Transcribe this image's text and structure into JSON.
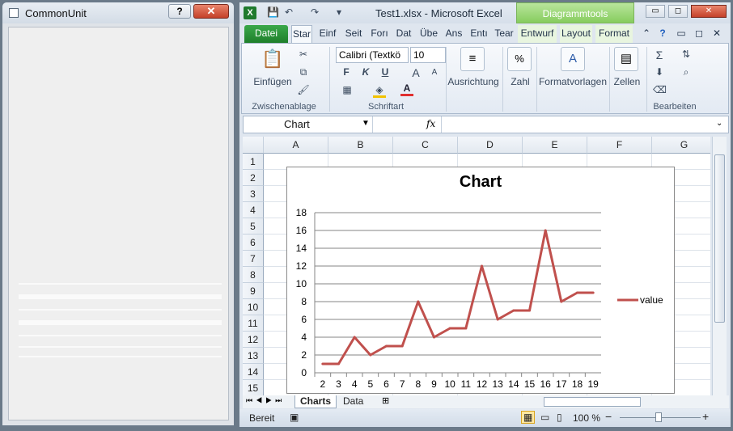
{
  "common_unit": {
    "title": "CommonUnit",
    "help_label": "?",
    "close_label": "✕"
  },
  "excel": {
    "title": "Test1.xlsx  -  Microsoft Excel",
    "icon_letter": "X",
    "context_tab_group": "Diagrammtools",
    "tabs": [
      "Datei",
      "Star",
      "Einf",
      "Seit",
      "Forı",
      "Dat",
      "Übe",
      "Ans",
      "Entı",
      "Tear",
      "Entwurf",
      "Layout",
      "Format"
    ],
    "window_buttons": [
      "▭",
      "◻",
      "✕"
    ],
    "ribbon": {
      "clipboard": {
        "paste": "Einfügen",
        "label": "Zwischenablage"
      },
      "font": {
        "name": "Calibri (Textkö",
        "size": "10",
        "bold": "F",
        "italic": "K",
        "underline": "U",
        "grow": "A",
        "shrink": "A",
        "label": "Schriftart"
      },
      "alignment": "Ausrichtung",
      "number": "Zahl",
      "styles": "Formatvorlagen",
      "cells": "Zellen",
      "editing": "Bearbeiten",
      "number_icon": "%"
    },
    "name_box": "Chart",
    "fx": "fx",
    "columns": [
      "A",
      "B",
      "C",
      "D",
      "E",
      "F",
      "G"
    ],
    "rows": [
      "1",
      "2",
      "3",
      "4",
      "5",
      "6",
      "7",
      "8",
      "9",
      "10",
      "11",
      "12",
      "13",
      "14",
      "15"
    ],
    "sheets": [
      "Charts",
      "Data"
    ],
    "status": "Bereit",
    "zoom": "100 %",
    "zoom_minus": "−",
    "zoom_plus": "+"
  },
  "chart_data": {
    "type": "line",
    "title": "Chart",
    "x": [
      2,
      3,
      4,
      5,
      6,
      7,
      8,
      9,
      10,
      11,
      12,
      13,
      14,
      15,
      16,
      17,
      18,
      19
    ],
    "series": [
      {
        "name": "value",
        "values": [
          1,
          1,
          4,
          2,
          3,
          3,
          8,
          4,
          5,
          5,
          12,
          6,
          7,
          7,
          16,
          8,
          9,
          9
        ],
        "color": "#c0504d"
      }
    ],
    "ylim": [
      0,
      18
    ],
    "yticks": [
      0,
      2,
      4,
      6,
      8,
      10,
      12,
      14,
      16,
      18
    ],
    "grid": true,
    "legend": "right"
  }
}
